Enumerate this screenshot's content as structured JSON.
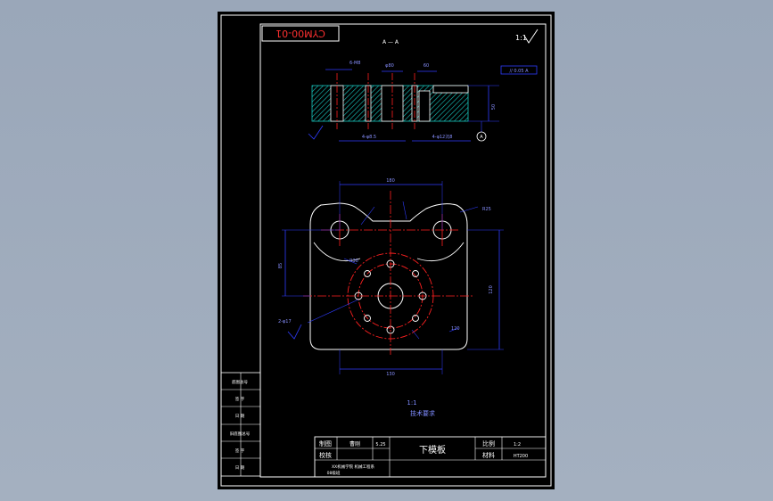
{
  "drawing": {
    "code": "CYM00-01",
    "section_label": "A — A",
    "view_label": "A",
    "roughness_note": "√",
    "tolerance_frame": "// 0.05 A"
  },
  "dimensions": {
    "top_length": "180",
    "mid_width": "120",
    "bottom_length": "130",
    "left_height": "85",
    "right_height": "120",
    "corner_radius": "R25",
    "fillet_radius": "R30",
    "hole_note": "2-φ17",
    "thickness": "50",
    "hole_pattern": "6-M8",
    "pcd_note": "φ80",
    "side_note": "60",
    "bottom_note_left": "4-φ8.5",
    "bottom_note_right": "4-φ12沉8"
  },
  "notes": {
    "line1": "1:1",
    "line2": "技术要求"
  },
  "left_strip": {
    "rows": [
      "底图总号",
      "签 字",
      "日 期",
      "旧底图总号",
      "签 字",
      "日 期"
    ]
  },
  "title_block": {
    "design_label": "制图",
    "designer": "曹刚",
    "date": "5.25",
    "check_label": "校核",
    "part_name": "下模板",
    "scale_label": "比例",
    "scale_value": "1:2",
    "material_label": "材料",
    "material_value": "HT200",
    "school": "XX机械学院 机械工程系",
    "class": "08级班"
  },
  "colors": {
    "sheet": "#000000",
    "border": "#ffffff",
    "outline": "#ffffff",
    "center": "#ff2020",
    "dimension": "#2f3cff",
    "hatch": "#18c8c0",
    "note": "#7f8cff"
  }
}
